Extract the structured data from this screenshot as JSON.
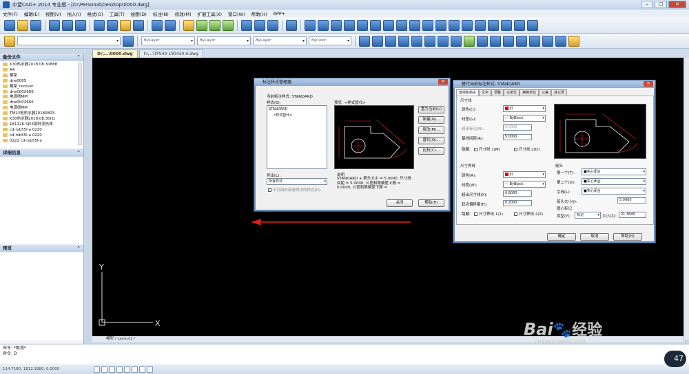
{
  "app": {
    "title": "中望CAD+ 2014 专业版 - [D:\\Personal\\Desktop\\0000.dwg]"
  },
  "menu": [
    "文件(F)",
    "编辑(E)",
    "视图(V)",
    "插入(I)",
    "格式(O)",
    "工具(T)",
    "绘图(D)",
    "标注(N)",
    "修改(M)",
    "扩展工具(X)",
    "窗口(W)",
    "帮助(H)",
    "APP+"
  ],
  "toolbar2": {
    "layer_combo1": "ByLayer",
    "layer_combo2": "ByLayer",
    "layer_combo3": "ByLayer",
    "color_combo": "ByColor"
  },
  "left_panel": {
    "header_files": "备份文件",
    "files": [
      "K30热水器2018.08.30888",
      "A4",
      "藏架",
      "drw0005",
      "藏架_recover",
      "drw0002666",
      "电源线MM",
      "drw0002666",
      "电源线MM",
      "TM13电热水器20180803",
      "K30热水器2018.08.30(1)",
      "181126-SJ55钢杯发热体",
      "cd-rsb55l-a 0220",
      "cd-rsb55l-a 0220",
      "0222 cd-rsb55l-a"
    ],
    "header_details": "详细信息",
    "header_preview": "预览"
  },
  "tabs": [
    "D:\\...\\0000.dwg",
    "F:\\...\\TPS40-190430-A.dwg"
  ],
  "layout_tabs": "模型 / Layout1 /",
  "command": {
    "line1": "命令: *取消*",
    "line2": "命令: D"
  },
  "status": {
    "coords": "114.7180, 1812.1880, 0.0000"
  },
  "axes": {
    "y": "Y",
    "x": "X"
  },
  "dlg1": {
    "title": "标注样式管理器",
    "current_style": "当前标注样式: STANDARD",
    "styles_label": "样式(S):",
    "style_items": [
      "STANDARD",
      "<样式替代>"
    ],
    "preview_label": "预览: <样式替代>",
    "list_label": "列出(L):",
    "list_value": "所有样式",
    "exclude_xref": "不列出外部参照中的样式(D)",
    "desc_label": "说明",
    "desc_text": "STANDARD + 箭头大小 = 5.0000, 尺寸线间距 = 5.0000, 公差和限偏差上限 = 0.0000, 公差和限偏差下限 =",
    "buttons": [
      "置为当前(U)",
      "新建(N)...",
      "修改(M)...",
      "替代(O)...",
      "比较(C)..."
    ],
    "close": "关闭",
    "help": "帮助(H)"
  },
  "dlg2": {
    "title": "替代当前标注样式: STANDARD",
    "tabs": [
      "直线和箭头",
      "文字",
      "调整",
      "主单位",
      "换算单位",
      "公差",
      "其它项"
    ],
    "dim_line": "尺寸线",
    "color_label": "颜色(C):",
    "color_value": "红",
    "lw_label": "线宽(G):",
    "lw_value": "— ByBlock",
    "ext_beyond_ticks_label": "超出标记(N):",
    "ext_beyond_ticks_value": "0.0000",
    "baseline_label": "基线间距(A):",
    "baseline_value": "5.0000",
    "suppress_label": "隐藏:",
    "suppress1": "尺寸线 1(M)",
    "suppress2": "尺寸线 2(D)",
    "ext_line": "尺寸界线",
    "ext_color_label": "颜色(R):",
    "ext_color_value": "红",
    "ext_lw_label": "线宽(W):",
    "ext_lw_value": "— ByBlock",
    "ext_beyond_label": "超出尺寸线(X):",
    "ext_beyond_value": "0.8000",
    "offset_label": "起点偏移量(F):",
    "offset_value": "0.2000",
    "ext_suppress1": "尺寸界线 1(1)",
    "ext_suppress2": "尺寸界线 2(2)",
    "arrows": "箭头",
    "first_label": "第一个(T):",
    "first_value": "■实心闭合",
    "second_label": "第二个(D):",
    "second_value": "■实心闭合",
    "leader_label": "引线(L):",
    "leader_value": "■实心闭合",
    "arrow_size_label": "箭头大小(I):",
    "arrow_size_value": "5.0000",
    "center_mark": "圆心标记",
    "type_label": "类型(Y):",
    "type_value": "标记",
    "size_label": "大小(Z):",
    "size_value": "21.3840",
    "ok": "确定",
    "cancel": "取消",
    "help": "帮助(H)"
  },
  "watermark": {
    "brand": "Bai",
    "brand2": "经验",
    "url": "jingyan.baidu.com"
  },
  "badge": "47"
}
